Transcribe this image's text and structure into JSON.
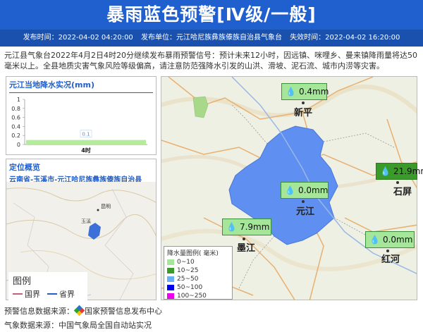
{
  "header": {
    "title": "暴雨蓝色预警[Ⅳ级/一般]"
  },
  "meta": {
    "publish_time": "发布时间：2022-04-02 04:20:00",
    "publisher": "发布单位：元江哈尼族彝族傣族自治县气象台",
    "expire_time": "失效时间：2022-04-02 16:20:00"
  },
  "description": "元江县气象台2022年4月2日4时20分继续发布暴雨预警信号：预计未来12小时，因远镇、咪哩乡、曼来镇降雨量将达50毫米以上。全县地质灾害气象风险等级偏高，请注意防范强降水引发的山洪、滑坡、泥石流、城市内涝等灾害。",
  "rain_panel": {
    "title": "元江当地降水实况(mm)"
  },
  "chart_data": {
    "type": "bar",
    "categories": [
      "4时"
    ],
    "values": [
      0.1
    ],
    "data_labels": [
      "0.1"
    ],
    "yticks": [
      "0",
      "0.2",
      "0.4",
      "0.6",
      "0.8",
      "1"
    ],
    "ylim": [
      0,
      1
    ],
    "bar_color": "#b4ec9c"
  },
  "location": {
    "title": "定位概览",
    "region": "云南省-玉溪市-元江哈尼族彝族傣族自治县",
    "legend_title": "图例",
    "legend_items": [
      {
        "label": "国界",
        "color": "#c0607a"
      },
      {
        "label": "省界",
        "color": "#1f5fce"
      }
    ],
    "map_labels": [
      "昆明",
      "玉溪"
    ]
  },
  "rain_legend": {
    "title": "降水量图例( 毫米)",
    "items": [
      {
        "label": "0~10",
        "color": "#a6e69a"
      },
      {
        "label": "10~25",
        "color": "#3a9b2a"
      },
      {
        "label": "25~50",
        "color": "#6aaef5"
      },
      {
        "label": "50~100",
        "color": "#0000ee"
      },
      {
        "label": "100~250",
        "color": "#ee00ee"
      }
    ]
  },
  "stations": [
    {
      "name": "新平",
      "value": "0.4mm"
    },
    {
      "name": "石屏",
      "value": "21.9mm"
    },
    {
      "name": "元江",
      "value": "0.0mm"
    },
    {
      "name": "墨江",
      "value": "7.9mm"
    },
    {
      "name": "红河",
      "value": "0.0mm"
    }
  ],
  "footer": {
    "warning_source_label": "预警信息数据来源：",
    "warning_source": "国家预警信息发布中心",
    "weather_source": "气象数据来源：中国气象局全国自动站实况"
  }
}
